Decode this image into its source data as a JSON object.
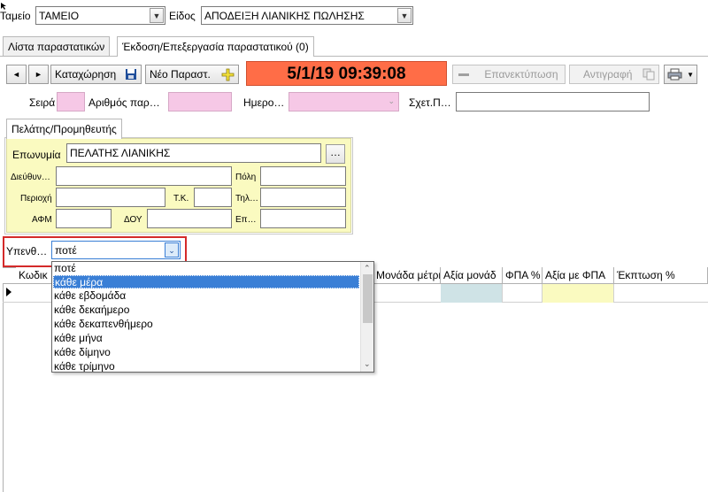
{
  "top": {
    "cashbox_label": "Ταμείο",
    "cashbox_value": "ΤΑΜΕΙΟ",
    "type_label": "Είδος",
    "type_value": "ΑΠΟΔΕΙΞΗ ΛΙΑΝΙΚΗΣ ΠΩΛΗΣΗΣ"
  },
  "tabs": [
    {
      "label": "Λίστα παραστατικών"
    },
    {
      "label": "Έκδοση/Επεξεργασία παραστατικού (0)"
    }
  ],
  "toolbar": {
    "prev": "◄",
    "next": "►",
    "save_label": "Καταχώρηση",
    "new_label": "Νέο Παραστ.",
    "datetime": "5/1/19 09:39:08",
    "reprint_label": "Επανεκτύπωση",
    "copy_label": "Αντιγραφή"
  },
  "doc": {
    "series_label": "Σειρά",
    "number_label": "Αριθμός παρ…",
    "date_label": "Ημερο…",
    "related_label": "Σχετ.Π…"
  },
  "customer": {
    "tab_label": "Πελάτης/Προμηθευτής",
    "name_label": "Επωνυμία",
    "name_value": "ΠΕΛΑΤΗΣ ΛΙΑΝΙΚΗΣ",
    "browse_label": "…",
    "address_label": "Διεύθυν…",
    "city_label": "Πόλη",
    "area_label": "Περιοχή",
    "zip_label": "Τ.Κ.",
    "phone_label": "Τηλ…",
    "afm_label": "ΑΦΜ",
    "doy_label": "ΔΟΥ",
    "profession_label": "Επ…"
  },
  "reminder": {
    "label": "Υπενθ…",
    "value": "ποτέ",
    "options": [
      "ποτέ",
      "κάθε μέρα",
      "κάθε εβδομάδα",
      "κάθε δεκαήμερο",
      "κάθε δεκαπενθήμερο",
      "κάθε μήνα",
      "κάθε δίμηνο",
      "κάθε τρίμηνο"
    ],
    "selected_index": 1
  },
  "grid": {
    "columns": [
      "Κωδικ",
      "Μονάδα μέτρη",
      "Αξία μονάδ",
      "ΦΠΑ %",
      "Αξία με ΦΠΑ",
      "Έκπτωση %"
    ]
  },
  "colors": {
    "datetime_bg": "#ff6d47",
    "pink_field": "#f6c8e6",
    "yellow_panel": "#fafac0",
    "highlight": "#3a7fd6",
    "red_outline": "#d42a2a"
  }
}
